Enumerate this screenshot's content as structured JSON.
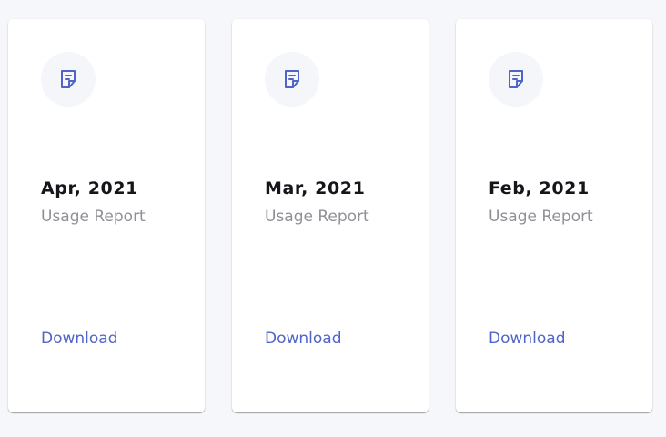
{
  "colors": {
    "page_background": "#f6f7fa",
    "card_background": "#ffffff",
    "icon_circle": "#f5f6f9",
    "accent": "#5064c8",
    "title_text": "#15161a",
    "subtitle_text": "#8f8f98"
  },
  "reports": [
    {
      "icon": "document-icon",
      "title": "Apr, 2021",
      "subtitle": "Usage Report",
      "action_label": "Download"
    },
    {
      "icon": "document-icon",
      "title": "Mar, 2021",
      "subtitle": "Usage Report",
      "action_label": "Download"
    },
    {
      "icon": "document-icon",
      "title": "Feb, 2021",
      "subtitle": "Usage Report",
      "action_label": "Download"
    }
  ]
}
